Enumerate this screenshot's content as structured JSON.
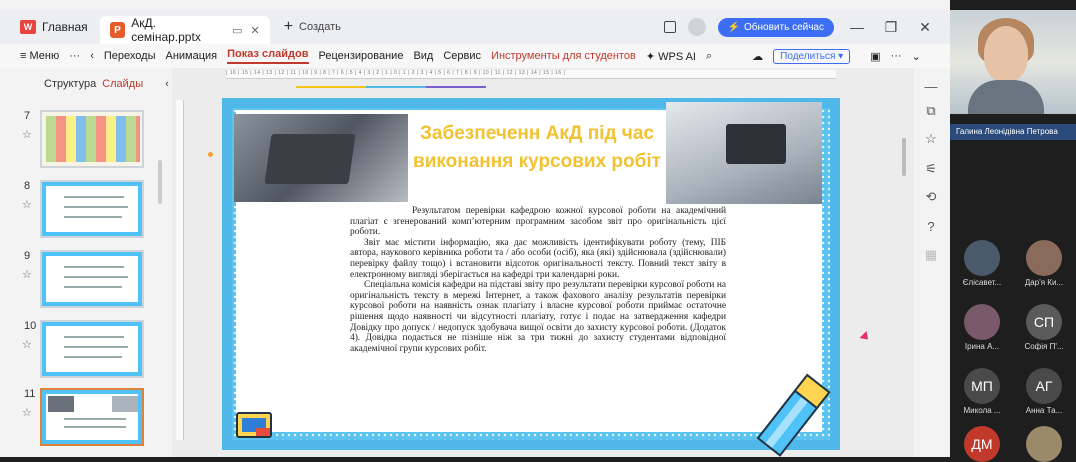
{
  "titlebar": {
    "home_tab": "Главная",
    "doc_tab": "АкД. семінар.pptx",
    "new_tab": "Создать",
    "update_button": "Обновить сейчас",
    "minimize": "—",
    "maximize": "❐",
    "close": "✕"
  },
  "menubar": {
    "menu": "≡ Меню",
    "more": "···",
    "items": [
      "Переходы",
      "Анимация",
      "Показ слайдов",
      "Рецензирование",
      "Вид",
      "Сервис",
      "Инструменты для студентов",
      "WPS AI"
    ],
    "share": "Поделиться"
  },
  "leftpanel": {
    "structure": "Структура",
    "slides": "Слайды",
    "thumbs": [
      {
        "num": "7"
      },
      {
        "num": "8"
      },
      {
        "num": "9"
      },
      {
        "num": "10"
      },
      {
        "num": "11"
      }
    ]
  },
  "ruler": "| 16 | 15 | 14 | 13 | 12 | 11 | 10 | 9 | 8 | 7 | 6 | 5 | 4 | 3 | 2 | 1 | 0 | 1 | 2 | 3 | 4 | 5 | 6 | 7 | 8 | 9 | 10 | 11 | 12 | 13 | 14 | 15 | 16 |",
  "slide": {
    "title": "Забезпеченн АкД під час виконання курсових робіт",
    "paragraphs": [
      "Результатом перевірки кафедрою кожної курсової роботи на академічний плагіат є згенерований комп’ютерним програмним засобом звіт про оригінальність цієї роботи.",
      "Звіт має містити інформацію, яка дає можливість ідентифікувати роботу (тему, ПІБ автора, наукового керівника роботи та / або особи (осіб), яка (які) здійснювала (здійснювали) перевірку файлу тощо) і встановити відсоток оригінальності тексту. Повний текст звіту в електронному вигляді зберігається на кафедрі три календарні роки.",
      "Спеціальна комісія кафедри на підставі звіту про результати перевірки курсової роботи на оригінальність тексту в мережі Інтернет, а також фахового аналізу результатів перевірки курсової роботи на наявність ознак плагіату і власне курсової роботи приймає остаточне рішення щодо наявності чи відсутності плагіату, готує і подає на затвердження кафедри Довідку про допуск / недопуск здобувача вищої освіти до захисту курсової роботи. (Додаток 4). Довідка подається не пізніше ніж за три тижні до захисту студентами відповідної академічної групи курсових робіт."
    ]
  },
  "video": {
    "presenter": "Галина Леонідівна Петрова",
    "participants": [
      {
        "initials": "",
        "name": "Єлісавет...",
        "color": "#4a5a6a"
      },
      {
        "initials": "",
        "name": "Дар'я Ки...",
        "color": "#8a6a5a"
      },
      {
        "initials": "",
        "name": "Ірина А...",
        "color": "#7a5a6a"
      },
      {
        "initials": "СП",
        "name": "Софія П'...",
        "color": "#5a5a5a"
      },
      {
        "initials": "МП",
        "name": "Микола ...",
        "color": "#4a4a4a"
      },
      {
        "initials": "АГ",
        "name": "Анна Та...",
        "color": "#4a4a4a"
      },
      {
        "initials": "ДМ",
        "name": "",
        "color": "#c0392b"
      },
      {
        "initials": "",
        "name": "",
        "color": "#9a8a6a"
      }
    ]
  },
  "colors": {
    "accent": "#c0392b",
    "slide_border": "#4fb8e8",
    "title": "#f2c230",
    "update": "#3b6ef5"
  }
}
